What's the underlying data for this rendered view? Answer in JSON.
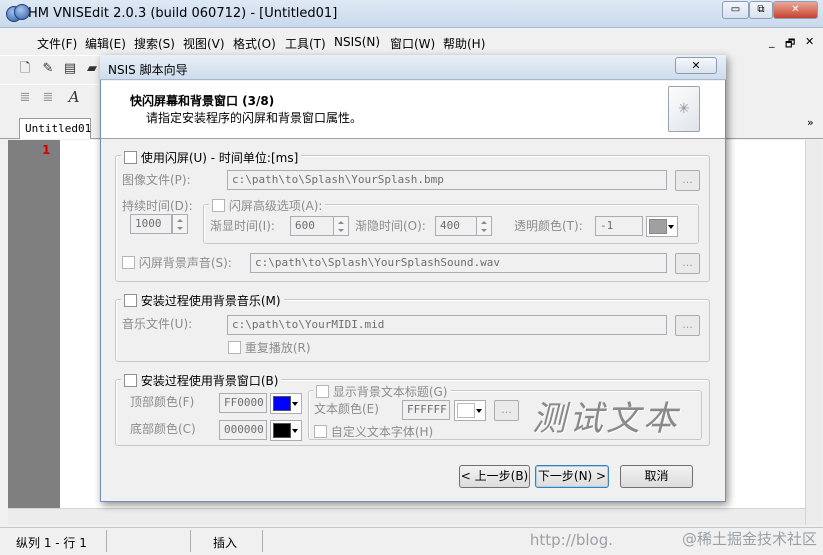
{
  "window": {
    "title": "HM VNISEdit 2.0.3 (build 060712) - [Untitled01]",
    "controls": [
      "▭",
      "⧉",
      "✕"
    ]
  },
  "menu": {
    "items": [
      "文件(F)",
      "编辑(E)",
      "搜索(S)",
      "视图(V)",
      "格式(O)",
      "工具(T)",
      "NSIS(N)",
      "窗口(W)",
      "帮助(H)"
    ],
    "mdi_controls": [
      "_",
      "🗗",
      "✕"
    ]
  },
  "tab": {
    "label": "Untitled01"
  },
  "editor": {
    "line_number": "1",
    "chevron": "»"
  },
  "status": {
    "position": "纵列 1 - 行 1",
    "mode": "插入"
  },
  "watermark": "@稀土掘金技术社区",
  "watermark_url": "http://blog.",
  "dialog": {
    "title": "NSIS 脚本向导",
    "close": "✕",
    "header_title": "快闪屏幕和背景窗口 (3/8)",
    "header_subtitle": "请指定安装程序的闪屏和背景窗口属性。",
    "splash": {
      "label": "使用闪屏(U) - 时间单位:[ms]",
      "image_label": "图像文件(P):",
      "image_path": "c:\\path\\to\\Splash\\YourSplash.bmp",
      "duration_label": "持续时间(D):",
      "duration": "1000",
      "advanced_label": "闪屏高级选项(A):",
      "fade_in_label": "渐显时间(I):",
      "fade_in": "600",
      "fade_out_label": "渐隐时间(O):",
      "fade_out": "400",
      "transparent_label": "透明颜色(T):",
      "transparent": "-1",
      "sound_label": "闪屏背景声音(S):",
      "sound_path": "c:\\path\\to\\Splash\\YourSplashSound.wav"
    },
    "music": {
      "label": "安装过程使用背景音乐(M)",
      "file_label": "音乐文件(U):",
      "file_path": "c:\\path\\to\\YourMIDI.mid",
      "repeat_label": "重复播放(R)"
    },
    "bgwindow": {
      "label": "安装过程使用背景窗口(B)",
      "top_color_label": "顶部颜色(F)",
      "top_color": "FF0000",
      "top_swatch": "#0000ff",
      "bottom_color_label": "底部颜色(C)",
      "bottom_color": "000000",
      "bottom_swatch": "#000000",
      "show_title_label": "显示背景文本标题(G)",
      "text_color_label": "文本颜色(E)",
      "text_color": "FFFFFF",
      "custom_font_label": "自定义文本字体(H)",
      "preview_text": "测试文本"
    },
    "buttons": {
      "back": "< 上一步(B)",
      "next": "下一步(N) >",
      "cancel": "取消"
    },
    "browse": "..."
  }
}
